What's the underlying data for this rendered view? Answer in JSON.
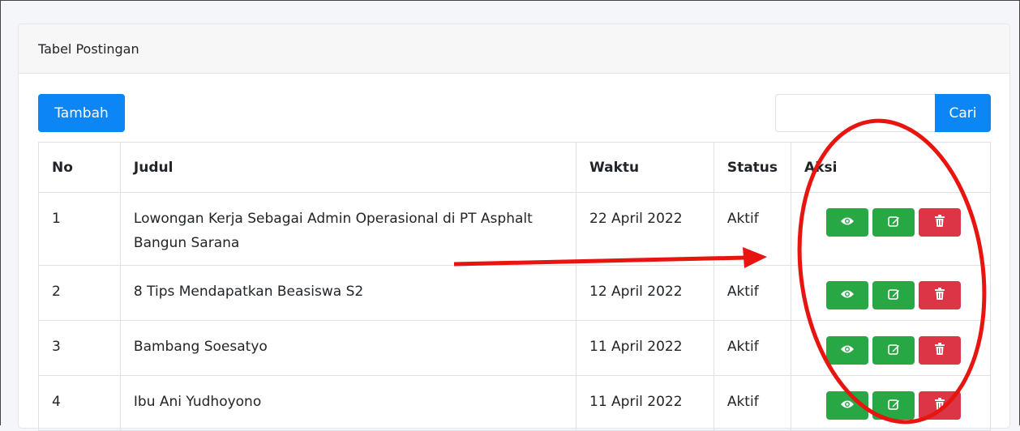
{
  "card": {
    "title": "Tabel Postingan"
  },
  "toolbar": {
    "add_label": "Tambah",
    "search_value": "",
    "search_label": "Cari"
  },
  "table": {
    "headers": {
      "no": "No",
      "judul": "Judul",
      "waktu": "Waktu",
      "status": "Status",
      "aksi": "Aksi"
    },
    "rows": [
      {
        "no": "1",
        "judul": "Lowongan Kerja Sebagai Admin Operasional di PT Asphalt Bangun Sarana",
        "waktu": "22 April 2022",
        "status": "Aktif"
      },
      {
        "no": "2",
        "judul": "8 Tips Mendapatkan Beasiswa S2",
        "waktu": "12 April 2022",
        "status": "Aktif"
      },
      {
        "no": "3",
        "judul": "Bambang Soesatyo",
        "waktu": "11 April 2022",
        "status": "Aktif"
      },
      {
        "no": "4",
        "judul": "Ibu Ani Yudhoyono",
        "waktu": "11 April 2022",
        "status": "Aktif"
      }
    ],
    "row_actions": [
      "eye-icon",
      "edit-icon",
      "trash-icon"
    ]
  },
  "annotation": {
    "arrow_color": "#e8140f",
    "circle_color": "#e8140f"
  },
  "colors": {
    "primary": "#0d86f5",
    "success": "#28a745",
    "danger": "#dc3545"
  }
}
